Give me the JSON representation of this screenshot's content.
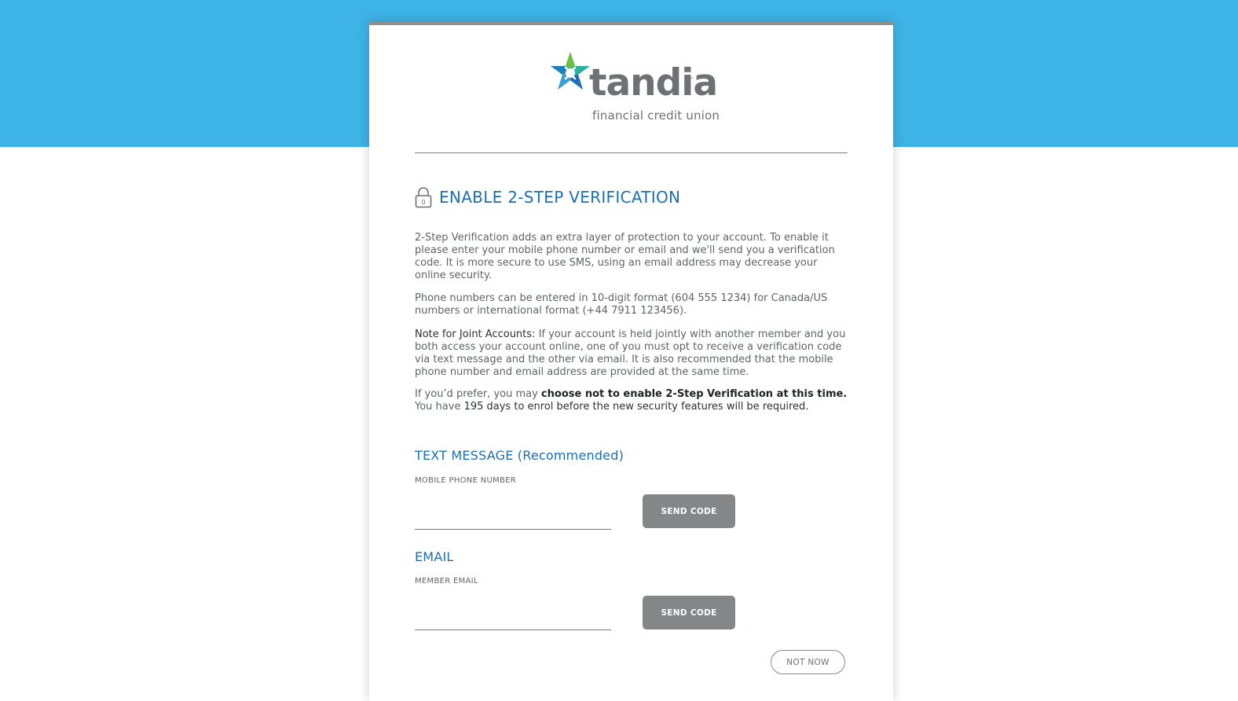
{
  "brand": {
    "name": "tandia",
    "trademark": "™",
    "tagline": "financial credit union",
    "colors": {
      "accent_blue": "#1a6fb5",
      "top_band": "#3db3e6",
      "button_gray": "#848688"
    }
  },
  "page": {
    "heading": "ENABLE 2-STEP VERIFICATION",
    "heading_icon": "lock-icon",
    "paragraphs": {
      "intro": "2-Step Verification adds an extra layer of protection to your account. To enable it please enter your mobile phone number or email and we'll send you a verification code. It is more secure to use SMS, using an email address may decrease your online security.",
      "phone_format": "Phone numbers can be entered in 10-digit format (604 555 1234) for Canada/US numbers or international format (+44 7911 123456).",
      "joint_label": "Note for Joint Accounts:",
      "joint_text": " If your account is held jointly with another member and you both access your account online, one of you must opt to receive a verification code via text message and the other via email. It is also recommended that the mobile phone number and email address are provided at the same time.",
      "optout_prefix": "If you’d prefer, you may ",
      "optout_bold": "choose not to enable 2-Step Verification at this time.",
      "optout_mid": " You have ",
      "optout_suffix": "195 days to enrol before the new security features will be required."
    }
  },
  "sms": {
    "section_title": "TEXT MESSAGE (Recommended)",
    "field_label": "MOBILE PHONE NUMBER",
    "value": "",
    "button_label": "SEND CODE"
  },
  "email": {
    "section_title": "EMAIL",
    "field_label": "MEMBER EMAIL",
    "value": "",
    "button_label": "SEND CODE"
  },
  "actions": {
    "not_now_label": "NOT NOW"
  }
}
